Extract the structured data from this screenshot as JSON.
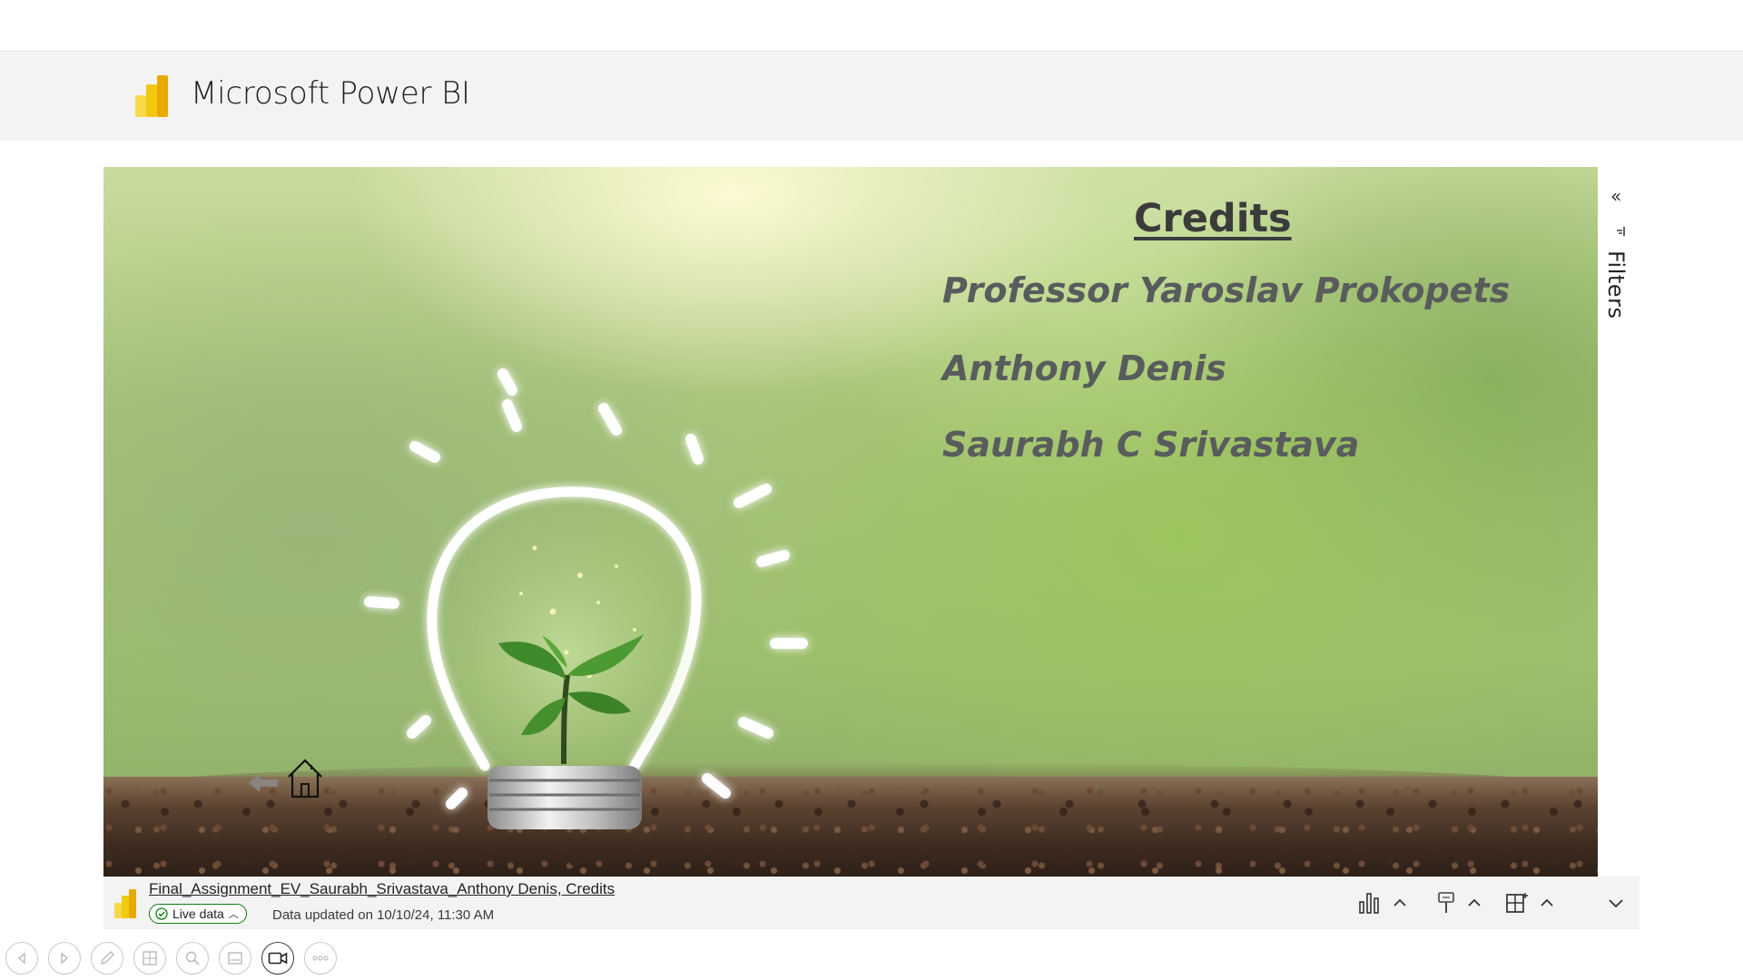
{
  "header": {
    "app_title": "Microsoft Power BI",
    "logo_icon": "power-bi-logo"
  },
  "report": {
    "credits_title": "Credits",
    "credits": [
      "Professor Yaroslav Prokopets",
      "Anthony Denis",
      "Saurabh C Srivastava"
    ],
    "nav_icons": [
      "back-arrow-icon",
      "home-icon"
    ]
  },
  "filters_pane": {
    "label": "Filters",
    "collapse_glyph": "«"
  },
  "footer": {
    "report_name": "Final_Assignment_EV_Saurabh_Srivastava_Anthony Denis, Credits",
    "live_label": "Live data",
    "updated": "Data updated on 10/10/24, 11:30 AM",
    "tools": [
      "visualization-icon",
      "format-painter-icon",
      "layout-icon"
    ]
  },
  "slideshow_toolbar": {
    "buttons": [
      "previous-icon",
      "next-icon",
      "pen-icon",
      "slides-icon",
      "zoom-icon",
      "subtitles-icon",
      "camera-icon",
      "more-icon"
    ],
    "active": "camera-icon"
  },
  "colors": {
    "pbi_yellow": "#f2c811",
    "pbi_dark": "#e8a900",
    "live_green": "#107c10",
    "credit_text": "#595c5c"
  }
}
